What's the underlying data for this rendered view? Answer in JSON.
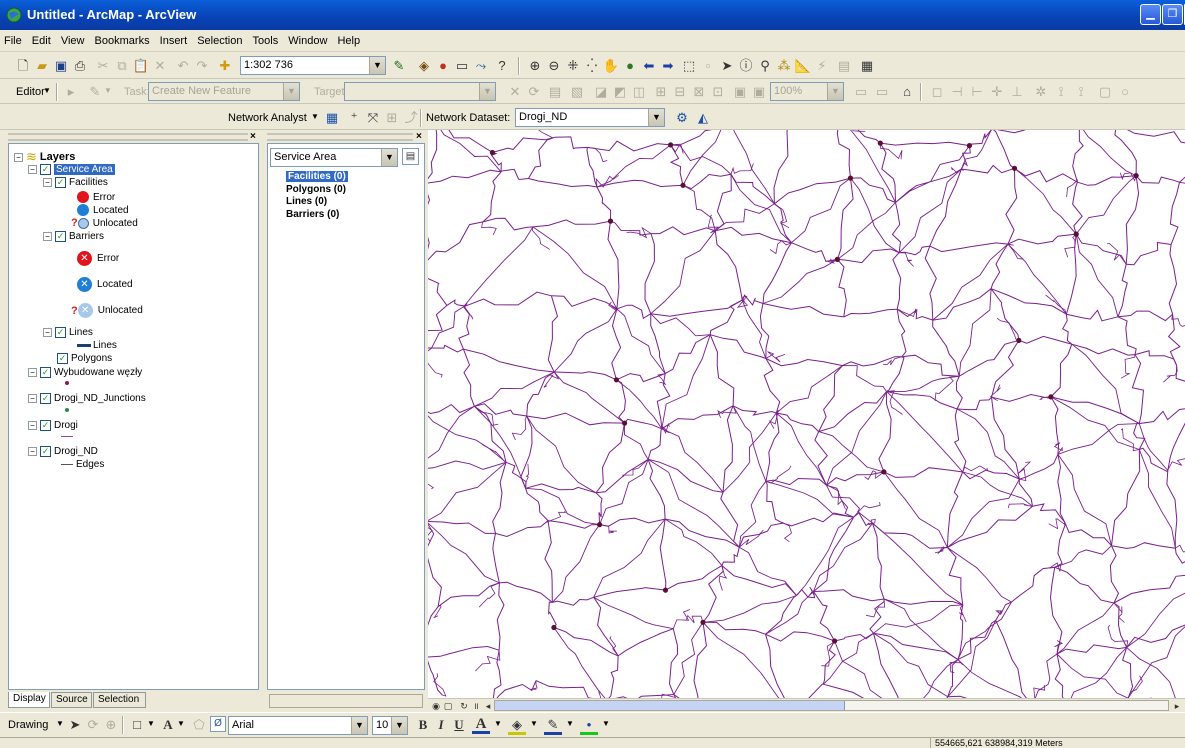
{
  "window": {
    "title": "Untitled - ArcMap - ArcView"
  },
  "menu": [
    "File",
    "Edit",
    "View",
    "Bookmarks",
    "Insert",
    "Selection",
    "Tools",
    "Window",
    "Help"
  ],
  "standard_toolbar": {
    "scale": "1:302 736"
  },
  "editor_toolbar": {
    "editor_label": "Editor",
    "task_label": "Task:",
    "task_value": "Create New Feature",
    "target_label": "Target:",
    "target_value": "",
    "zoom_value": "100%"
  },
  "network_toolbar": {
    "network_analyst_label": "Network Analyst",
    "network_dataset_label": "Network Dataset:",
    "network_dataset_value": "Drogi_ND"
  },
  "toc": {
    "root": "Layers",
    "service_area": "Service Area",
    "facilities": "Facilities",
    "fac_error": "Error",
    "fac_located": "Located",
    "fac_unlocated": "Unlocated",
    "barriers": "Barriers",
    "bar_error": "Error",
    "bar_located": "Located",
    "bar_unlocated": "Unlocated",
    "lines": "Lines",
    "lines_sub": "Lines",
    "polygons": "Polygons",
    "wybudowane": "Wybudowane węzły",
    "junctions": "Drogi_ND_Junctions",
    "drogi": "Drogi",
    "drogi_nd": "Drogi_ND",
    "edges": "Edges",
    "question_mark": "?",
    "tabs": [
      "Display",
      "Source",
      "Selection"
    ]
  },
  "na_window": {
    "combo": "Service Area",
    "items": [
      "Facilities (0)",
      "Polygons (0)",
      "Lines (0)",
      "Barriers (0)"
    ]
  },
  "drawing_toolbar": {
    "drawing_label": "Drawing",
    "font_name": "Arial",
    "font_size": "10",
    "bold": "B",
    "italic": "I",
    "underline": "U",
    "font_color": "A"
  },
  "status": {
    "coords": "554665,621 638984,319 Meters"
  },
  "colors": {
    "road": "#7a1f8c",
    "node": "#5a1030",
    "titlebar": "#0842b5",
    "selection": "#316ac5"
  }
}
